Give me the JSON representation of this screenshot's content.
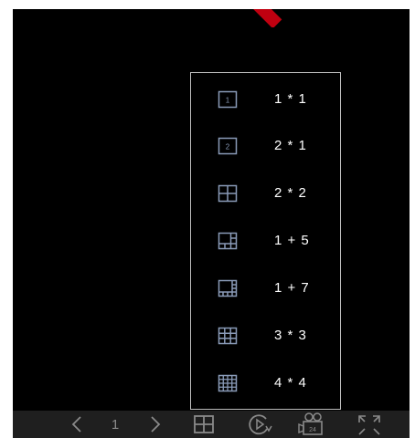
{
  "layout_menu": {
    "items": [
      {
        "label": "1 * 1",
        "icon": "layout-1x1-icon",
        "icon_text": "1"
      },
      {
        "label": "2 * 1",
        "icon": "layout-2x1-icon",
        "icon_text": "2"
      },
      {
        "label": "2 * 2",
        "icon": "layout-2x2-icon"
      },
      {
        "label": "1 + 5",
        "icon": "layout-1plus5-icon"
      },
      {
        "label": "1 + 7",
        "icon": "layout-1plus7-icon"
      },
      {
        "label": "3 * 3",
        "icon": "layout-3x3-icon"
      },
      {
        "label": "4 * 4",
        "icon": "layout-4x4-icon"
      }
    ]
  },
  "toolbar": {
    "page_number": "1",
    "record_badge": "24",
    "buttons": [
      "prev-page-icon",
      "next-page-icon",
      "split-layout-icon",
      "playback-icon",
      "recorder-icon",
      "fullscreen-icon"
    ]
  },
  "colors": {
    "background": "#000000",
    "menu_border": "#bdbdbd",
    "icon_stroke": "#8a9bb8",
    "toolbar_bg": "#1f1f1f",
    "toolbar_icon": "#8a8a8a",
    "marker": "#c00010"
  }
}
